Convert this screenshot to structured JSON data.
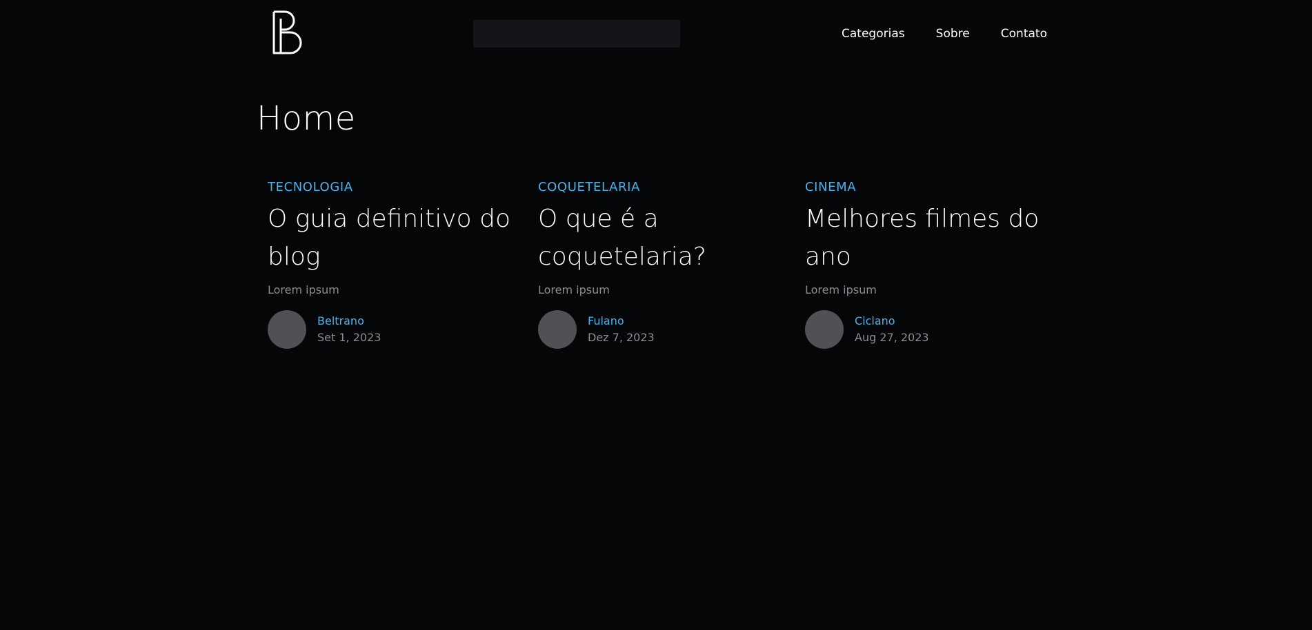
{
  "header": {
    "logo_name": "b-logo-icon",
    "search": {
      "value": "",
      "placeholder": ""
    },
    "nav": [
      {
        "label": "Categorias"
      },
      {
        "label": "Sobre"
      },
      {
        "label": "Contato"
      }
    ]
  },
  "page": {
    "title": "Home"
  },
  "posts": [
    {
      "category": "TECNOLOGIA",
      "title": "O guia definitivo do blog",
      "excerpt": "Lorem ipsum",
      "author": "Beltrano",
      "date": "Set 1, 2023"
    },
    {
      "category": "COQUETELARIA",
      "title": "O que é a coquetelaria?",
      "excerpt": "Lorem ipsum",
      "author": "Fulano",
      "date": "Dez 7, 2023"
    },
    {
      "category": "CINEMA",
      "title": "Melhores filmes do ano",
      "excerpt": "Lorem ipsum",
      "author": "Ciclano",
      "date": "Aug 27, 2023"
    }
  ],
  "colors": {
    "background": "#050608",
    "accent": "#4fb0e8",
    "muted_text": "#8b8d93",
    "search_bg": "#141518",
    "avatar": "#505154"
  }
}
